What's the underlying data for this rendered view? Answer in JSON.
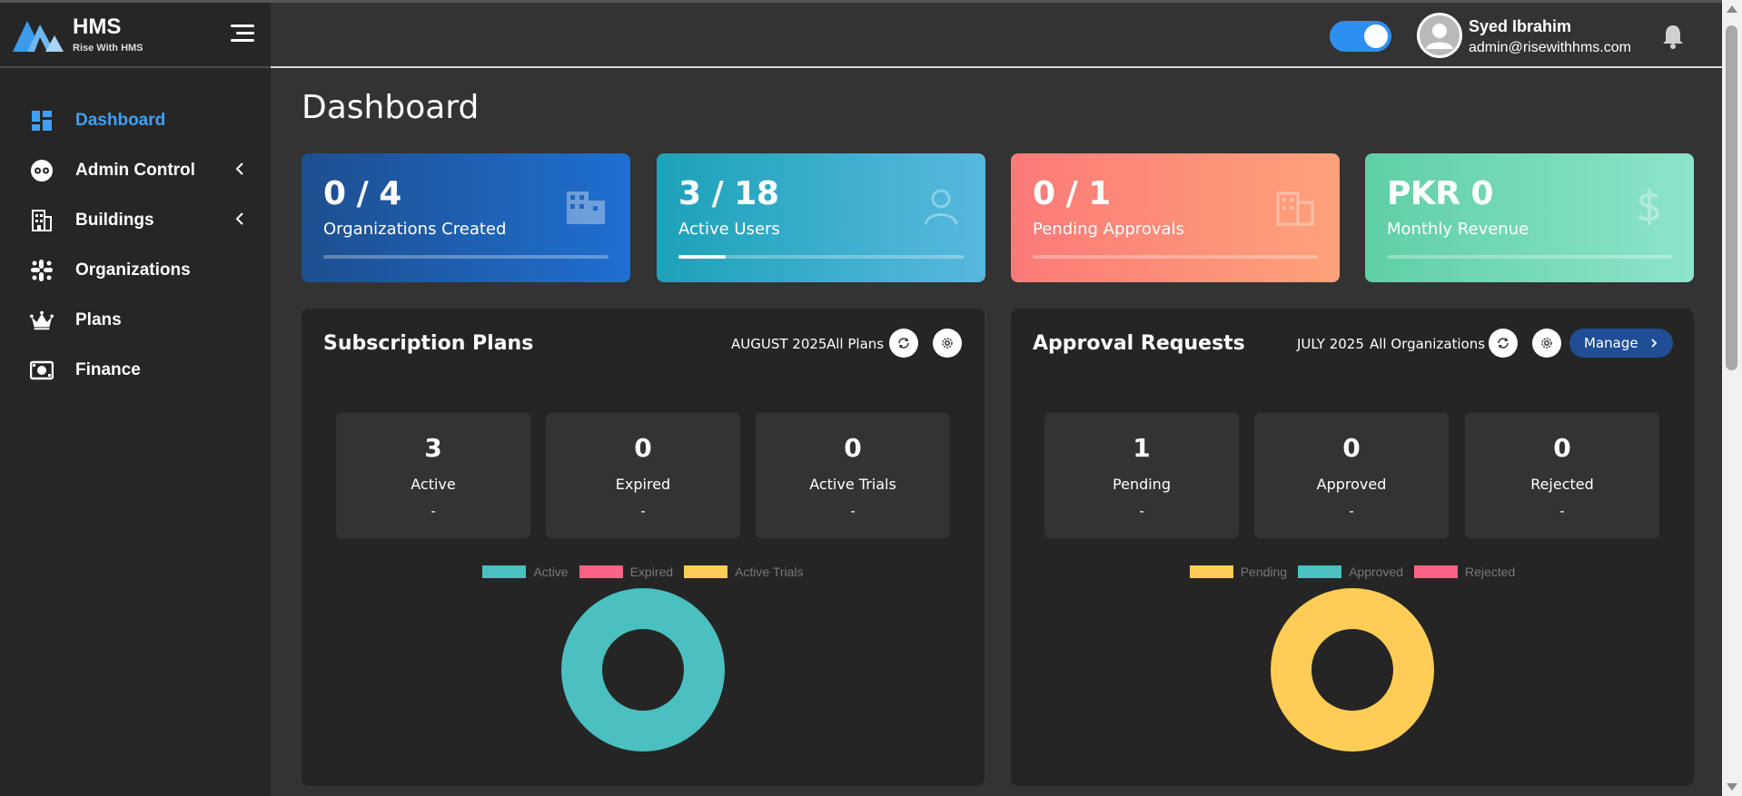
{
  "brand": {
    "name": "HMS",
    "tagline": "Rise With HMS"
  },
  "sidebar": {
    "items": [
      {
        "label": "Dashboard",
        "icon": "dashboard-icon",
        "active": true
      },
      {
        "label": "Admin Control",
        "icon": "admin-control-icon",
        "has_submenu": true
      },
      {
        "label": "Buildings",
        "icon": "buildings-icon",
        "has_submenu": true
      },
      {
        "label": "Organizations",
        "icon": "organizations-icon"
      },
      {
        "label": "Plans",
        "icon": "crown-icon"
      },
      {
        "label": "Finance",
        "icon": "finance-icon"
      }
    ]
  },
  "header": {
    "toggle_on": true,
    "user_name": "Syed Ibrahim",
    "user_email": "admin@risewithhms.com"
  },
  "page_title": "Dashboard",
  "stats": [
    {
      "value": "0 / 4",
      "label": "Organizations Created",
      "progress": 0.0,
      "colors": [
        "#1e4f8f",
        "#1f6fd1"
      ],
      "icon": "building-icon"
    },
    {
      "value": "3 / 18",
      "label": "Active Users",
      "progress": 0.167,
      "colors": [
        "#1ca2b8",
        "#58b8df"
      ],
      "icon": "user-icon"
    },
    {
      "value": "0 / 1",
      "label": "Pending Approvals",
      "progress": 0.0,
      "colors": [
        "#fb7a78",
        "#fea27a"
      ],
      "icon": "building-icon"
    },
    {
      "value": "PKR 0",
      "label": "Monthly Revenue",
      "progress": 0.0,
      "colors": [
        "#5fcfa5",
        "#8ee4cc"
      ],
      "icon": "dollar-icon"
    }
  ],
  "subscription": {
    "title": "Subscription Plans",
    "period": "AUGUST 2025",
    "filter": "All Plans",
    "cards": [
      {
        "value": "3",
        "label": "Active",
        "sub": "-"
      },
      {
        "value": "0",
        "label": "Expired",
        "sub": "-"
      },
      {
        "value": "0",
        "label": "Active Trials",
        "sub": "-"
      }
    ]
  },
  "approval": {
    "title": "Approval Requests",
    "period": "JULY 2025",
    "filter": "All Organizations",
    "manage_label": "Manage",
    "cards": [
      {
        "value": "1",
        "label": "Pending",
        "sub": "-"
      },
      {
        "value": "0",
        "label": "Approved",
        "sub": "-"
      },
      {
        "value": "0",
        "label": "Rejected",
        "sub": "-"
      }
    ]
  },
  "chart_data": [
    {
      "type": "pie",
      "categories": [
        "Active",
        "Expired",
        "Active Trials"
      ],
      "values": [
        3,
        0,
        0
      ],
      "colors": [
        "#4bc0c0",
        "#ff6384",
        "#ffcd56"
      ],
      "legend": "top",
      "style": "doughnut"
    },
    {
      "type": "pie",
      "categories": [
        "Pending",
        "Approved",
        "Rejected"
      ],
      "values": [
        1,
        0,
        0
      ],
      "colors": [
        "#ffcd56",
        "#4bc0c0",
        "#ff6384"
      ],
      "legend": "top",
      "style": "doughnut"
    }
  ]
}
